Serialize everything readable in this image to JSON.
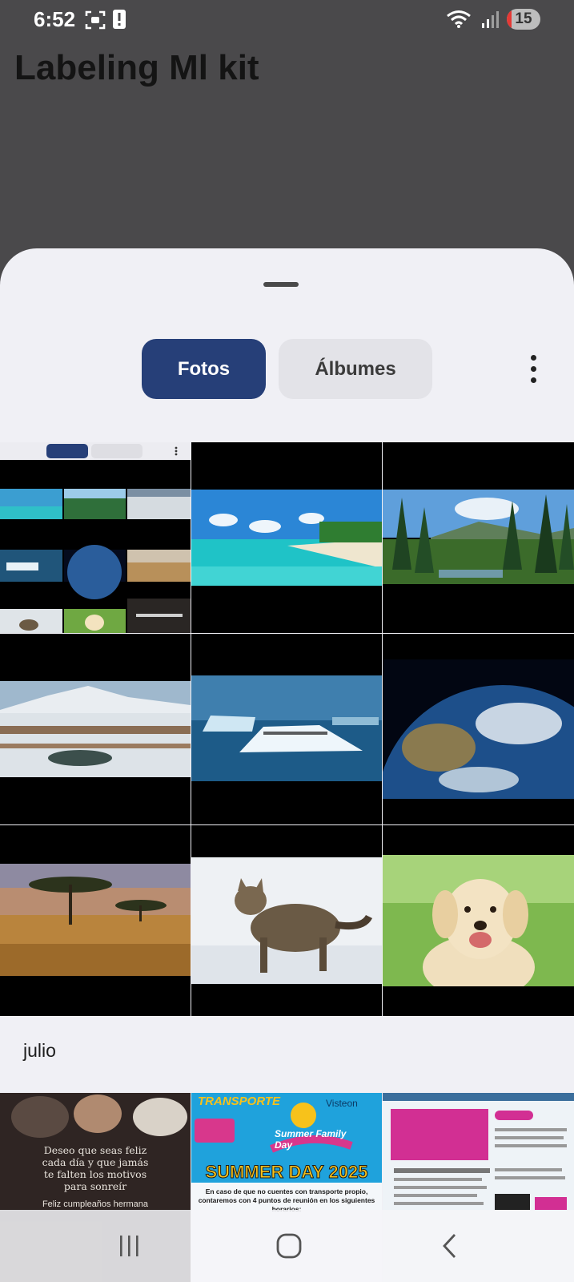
{
  "status_bar": {
    "time": "6:52",
    "battery_level": "15",
    "battery_fraction": 0.15
  },
  "app_title": "Labeling Ml kit",
  "tabs": [
    {
      "label": "Fotos",
      "selected": true
    },
    {
      "label": "Álbumes",
      "selected": false
    }
  ],
  "photos": [
    {
      "subject": "app-screenshot"
    },
    {
      "subject": "tropical-beach"
    },
    {
      "subject": "pine-forest-mountains"
    },
    {
      "subject": "snowy-tundra"
    },
    {
      "subject": "iceberg-penguins"
    },
    {
      "subject": "earth-from-space"
    },
    {
      "subject": "savanna-acacia-trees"
    },
    {
      "subject": "cat-in-snow"
    },
    {
      "subject": "labrador-puppy"
    }
  ],
  "section": {
    "label": "julio"
  },
  "july_photos": [
    {
      "subject": "birthday-card",
      "text_line_1": "Deseo que seas feliz",
      "text_line_2": "cada día y que jamás",
      "text_line_3": "te falten los motivos",
      "text_line_4": "para sonreír",
      "text_line_5": "Feliz cumpleaños hermana"
    },
    {
      "subject": "summer-day-flyer",
      "header": "TRANSPORTE",
      "brand": "Visteon",
      "event": "Summer Family Day",
      "headline": "SUMMER DAY 2025",
      "caption": "En caso de que no cuentes con transporte propio, contaremos con 4 puntos de reunión en los siguientes horarios:"
    },
    {
      "subject": "event-rules-flyer"
    }
  ],
  "colors": {
    "primary": "#263f78",
    "sheet": "#f0f0f5",
    "scrim": "#4a494b"
  }
}
